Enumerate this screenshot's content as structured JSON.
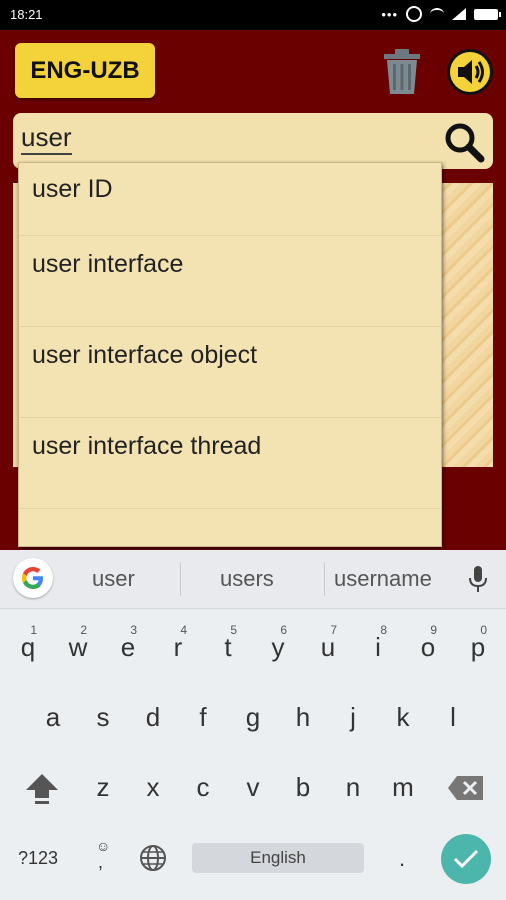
{
  "status_bar": {
    "time": "18:21",
    "icons": [
      "dots-icon",
      "alarm-icon",
      "signal-icon",
      "wifi-icon",
      "battery-icon"
    ]
  },
  "app": {
    "language_button": "ENG-UZB",
    "search": {
      "value": "user"
    },
    "suggestions": [
      "user ID",
      "user interface",
      "user interface object",
      "user interface thread",
      ""
    ],
    "colors": {
      "background": "#6b0000",
      "button": "#f4d33a",
      "search_bg": "#f2e1ad"
    }
  },
  "keyboard": {
    "suggestions": [
      "user",
      "users",
      "username"
    ],
    "row1": [
      {
        "k": "q",
        "n": "1"
      },
      {
        "k": "w",
        "n": "2"
      },
      {
        "k": "e",
        "n": "3"
      },
      {
        "k": "r",
        "n": "4"
      },
      {
        "k": "t",
        "n": "5"
      },
      {
        "k": "y",
        "n": "6"
      },
      {
        "k": "u",
        "n": "7"
      },
      {
        "k": "i",
        "n": "8"
      },
      {
        "k": "o",
        "n": "9"
      },
      {
        "k": "p",
        "n": "0"
      }
    ],
    "row2": [
      "a",
      "s",
      "d",
      "f",
      "g",
      "h",
      "j",
      "k",
      "l"
    ],
    "row3": [
      "z",
      "x",
      "c",
      "v",
      "b",
      "n",
      "m"
    ],
    "symbols_key": "?123",
    "emoji_key": ",",
    "space_label": "English",
    "period_key": "."
  }
}
